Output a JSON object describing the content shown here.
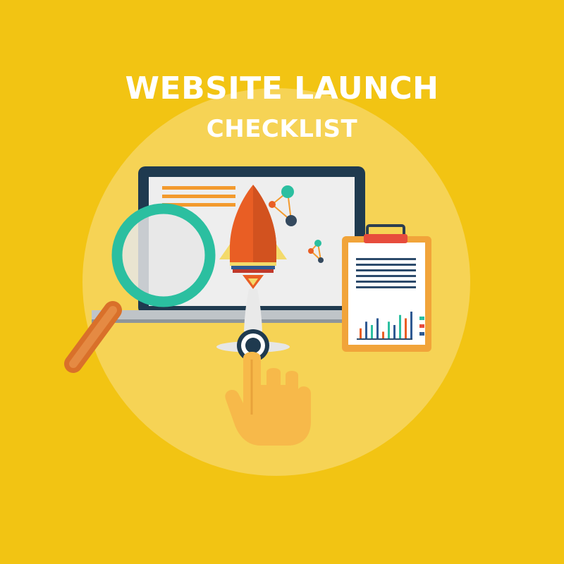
{
  "title": {
    "line1": "WEBSITE LAUNCH",
    "line2": "CHECKLIST"
  },
  "colors": {
    "background": "#F2C413",
    "circle": "#F6D355",
    "monitor_frame": "#1F3A4F",
    "screen": "#EEEEEE",
    "rocket_orange": "#E95E24",
    "magnifier_teal": "#2BBFA0",
    "handle_orange": "#D9702A",
    "clipboard_orange": "#F1A43A",
    "hand": "#F7B94A"
  },
  "icons": {
    "monitor": "monitor-icon",
    "rocket": "rocket-icon",
    "magnifier": "magnifying-glass-icon",
    "clipboard": "clipboard-icon",
    "hand": "pointing-hand-icon",
    "network": "network-nodes-icon"
  },
  "clipboard_chart": {
    "type": "bar",
    "values": [
      3,
      5,
      4,
      6,
      2,
      5,
      4,
      7,
      6,
      8
    ]
  }
}
